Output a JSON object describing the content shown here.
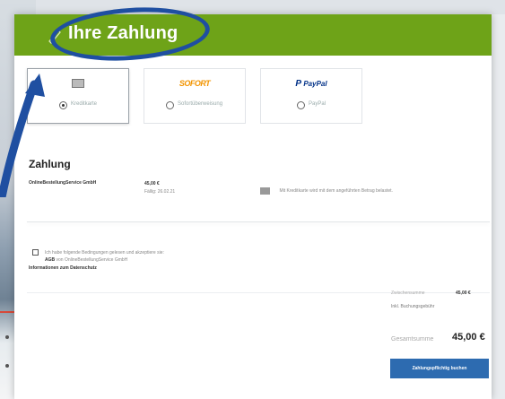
{
  "header": {
    "title": "Ihre Zahlung"
  },
  "payment_methods": [
    {
      "logo": "",
      "label": "Kreditkarte",
      "selected": true
    },
    {
      "logo": "SOFORT",
      "label": "Sofortüberweisung",
      "selected": false
    },
    {
      "logo": "PayPal",
      "label": "PayPal",
      "selected": false
    }
  ],
  "payment": {
    "heading": "Zahlung",
    "merchant": "OnlineBestellungService GmbH",
    "amount": "45,00 €",
    "due": "Fällig: 26.02.21",
    "card_text": "Mit Kreditkarte wird mit dem angeführten Betrag belastet."
  },
  "terms": {
    "line1": "Ich habe folgende Bedingungen gelesen und akzeptiere sie:",
    "agb_label": "AGB",
    "agb_rest": " von OnlineBestellungService GmbH",
    "privacy": "Informationen zum Datenschutz"
  },
  "summary": {
    "subtotal_label": "Zwischensumme",
    "subtotal_value": "45,00 €",
    "vat_text": "Inkl. Buchungsgebühr",
    "total_label": "Gesamtsumme",
    "total_value": "45,00 €",
    "button_label": "Zahlungspflichtig buchen"
  }
}
